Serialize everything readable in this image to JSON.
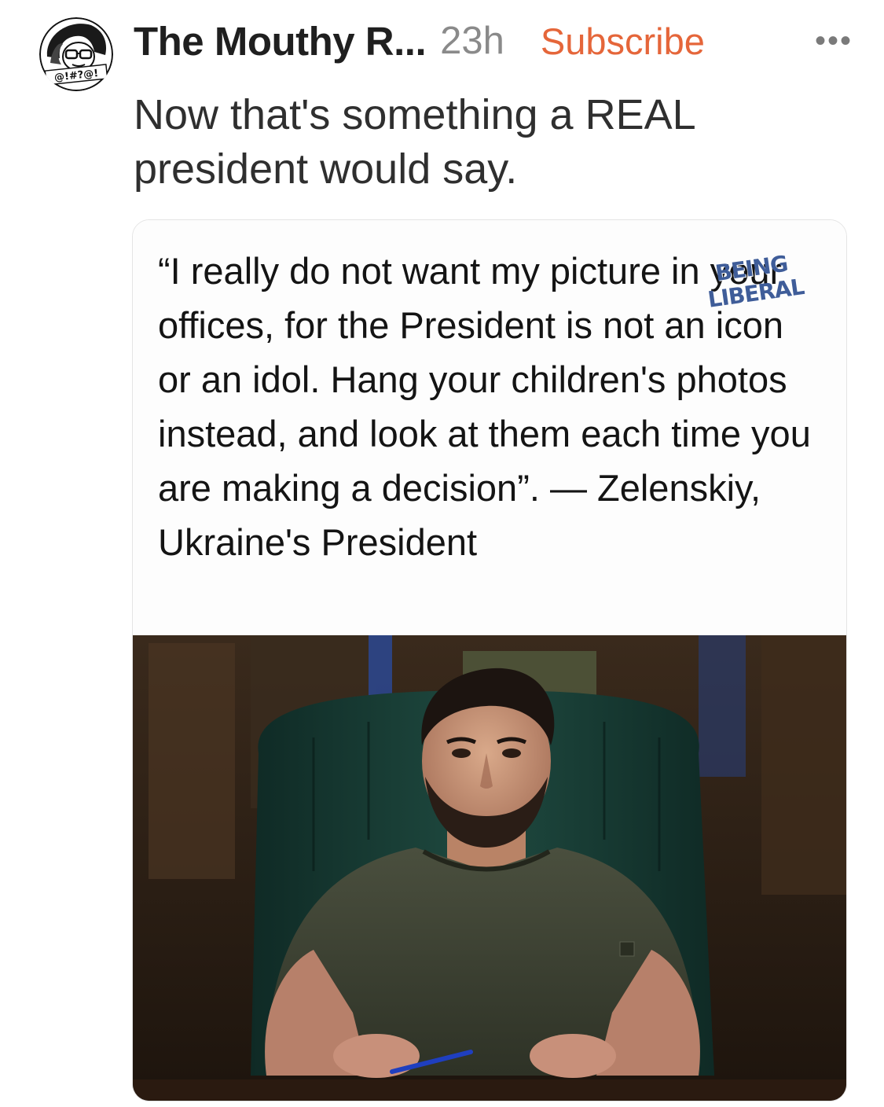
{
  "post": {
    "author": "The Mouthy R...",
    "time": "23h",
    "subscribe_label": "Subscribe",
    "more_label": "•••",
    "text": "Now that's something a REAL president would say."
  },
  "avatar": {
    "badge_text": "@!#?@!"
  },
  "card": {
    "quote": "“I really do not want my picture in your offices, for the President is not an icon or an idol. Hang your children's photos instead, and look at them each time you are making a decision”. — Zelenskiy, Ukraine's President",
    "watermark_line1": "BEING",
    "watermark_line2": "LIBERAL"
  },
  "colors": {
    "accent": "#e5663a",
    "muted": "#8a8a8a",
    "watermark": "#3f5d99"
  }
}
